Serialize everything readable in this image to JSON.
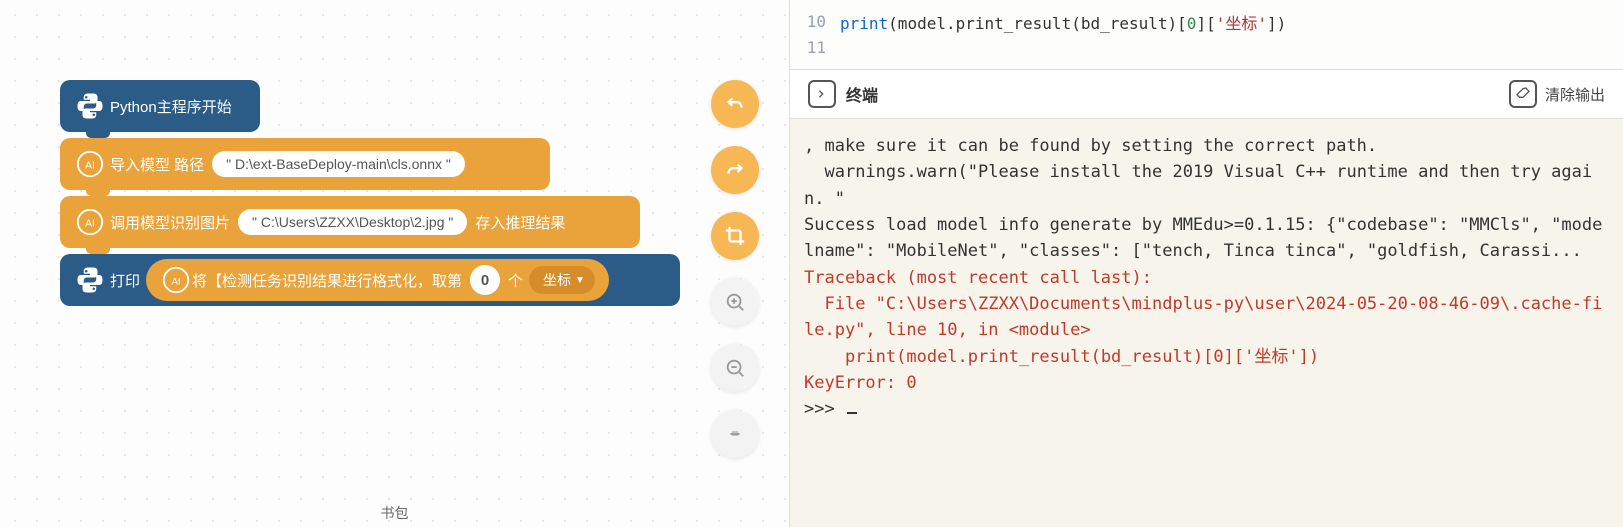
{
  "blocks": {
    "start": "Python主程序开始",
    "import_prefix": "导入模型 路径",
    "import_path": "\" D:\\ext-BaseDeploy-main\\cls.onnx \"",
    "call_prefix": "调用模型识别图片",
    "call_path": "\" C:\\Users\\ZZXX\\Desktop\\2.jpg \"",
    "call_suffix": "存入推理结果",
    "print_label": "打印",
    "fmt_prefix": "将【检测任务识别结果进行格式化，取第",
    "fmt_index": "0",
    "fmt_unit": "个",
    "fmt_dropdown": "坐标"
  },
  "tools": {
    "undo": "undo",
    "redo": "redo",
    "crop": "crop",
    "zoom_in": "zoom-in",
    "zoom_out": "zoom-out",
    "reset": "reset-zoom"
  },
  "bottom_title": "书包",
  "code": {
    "lines": [
      {
        "num": "10",
        "tokens": [
          {
            "t": "    ",
            "c": "t-txt"
          },
          {
            "t": "print",
            "c": "t-fn"
          },
          {
            "t": "(model.print_result(bd_result)[",
            "c": "t-txt"
          },
          {
            "t": "0",
            "c": "t-num"
          },
          {
            "t": "][",
            "c": "t-txt"
          },
          {
            "t": "'坐标'",
            "c": "t-str"
          },
          {
            "t": "])",
            "c": "t-txt"
          }
        ]
      },
      {
        "num": "11",
        "tokens": []
      }
    ]
  },
  "terminal": {
    "title": "终端",
    "clear": "清除输出",
    "lines": [
      {
        "c": "n",
        "t": ", make sure it can be found by setting the correct path."
      },
      {
        "c": "n",
        "t": "  warnings.warn(\"Please install the 2019 Visual C++ runtime and then try again. \""
      },
      {
        "c": "n",
        "t": "Success load model info generate by MMEdu>=0.1.15: {\"codebase\": \"MMCls\", \"modelname\": \"MobileNet\", \"classes\": [\"tench, Tinca tinca\", \"goldfish, Carassi..."
      },
      {
        "c": "e",
        "t": "Traceback (most recent call last):"
      },
      {
        "c": "e",
        "t": "  File \"C:\\Users\\ZZXX\\Documents\\mindplus-py\\user\\2024-05-20-08-46-09\\.cache-file.py\", line 10, in <module>"
      },
      {
        "c": "e",
        "t": "    print(model.print_result(bd_result)[0]['坐标'])"
      },
      {
        "c": "e",
        "t": "KeyError: 0"
      },
      {
        "c": "p",
        "t": ">>> "
      }
    ]
  }
}
